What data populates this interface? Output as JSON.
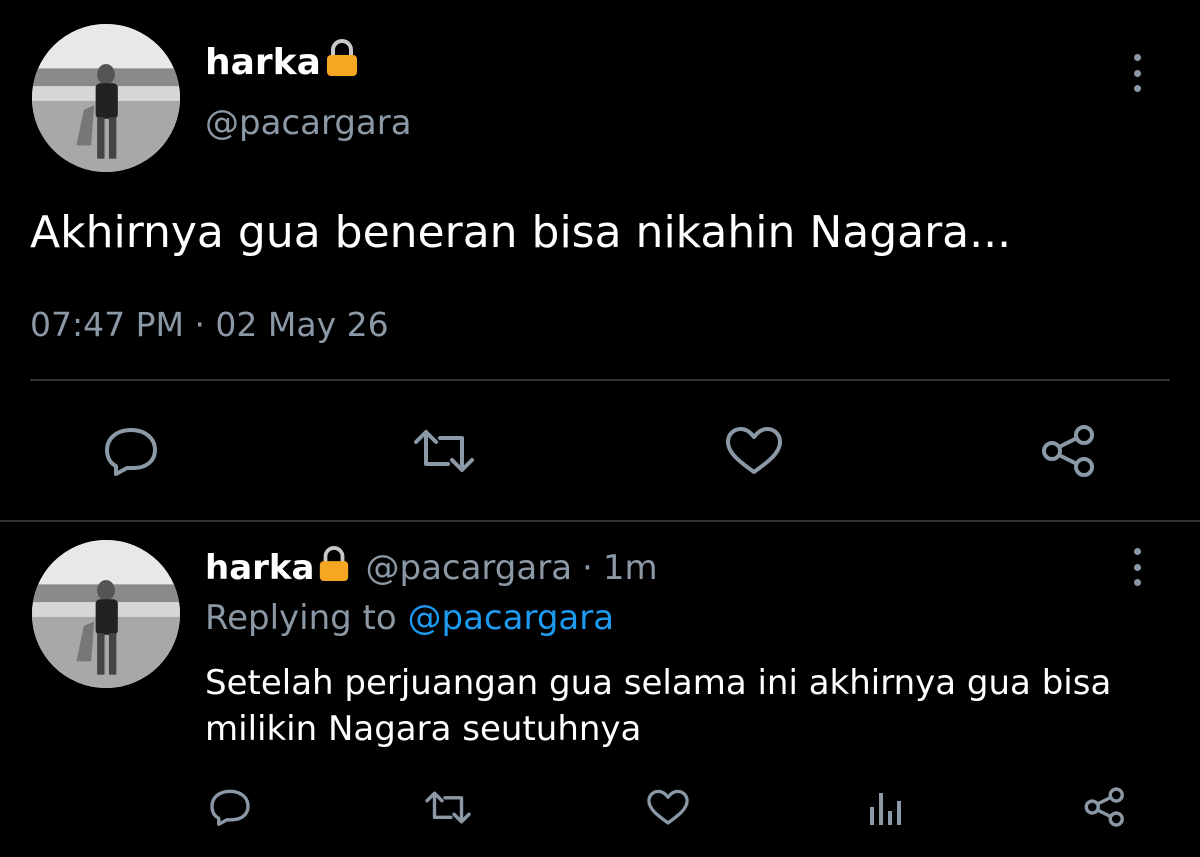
{
  "main_tweet": {
    "display_name": "harka",
    "lock_glyph": "🔒",
    "handle": "@pacargara",
    "text": "Akhirnya gua beneran bisa nikahin Nagara...",
    "timestamp": "07:47 PM · 02 May 26",
    "actions": [
      "reply-icon",
      "retweet-icon",
      "like-icon",
      "share-icon"
    ]
  },
  "reply_tweet": {
    "display_name": "harka",
    "lock_glyph": "🔒",
    "handle": "@pacargara",
    "separator": "·",
    "age": "1m",
    "replying_prefix": "Replying to",
    "replying_handle": "@pacargara",
    "text_line1": "Setelah perjuangan gua selama ini akhirnya gua bisa",
    "text_line2": "milikin Nagara seutuhnya",
    "actions": [
      "reply-icon",
      "retweet-icon",
      "like-icon",
      "analytics-icon",
      "share-icon"
    ]
  },
  "colors": {
    "background": "#000000",
    "text": "#ffffff",
    "muted": "#8b98a5",
    "link": "#1d9bf0",
    "divider": "#2f3336",
    "lock": "#f5a623"
  }
}
